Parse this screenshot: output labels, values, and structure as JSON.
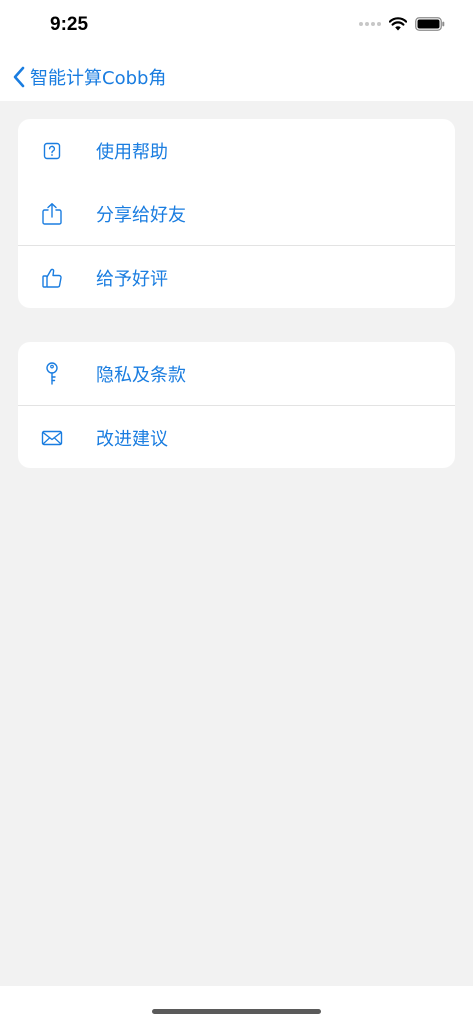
{
  "status_bar": {
    "time": "9:25"
  },
  "nav": {
    "title": "智能计算Cobb角",
    "back_icon": "chevron-left-icon"
  },
  "groups": [
    {
      "items": [
        {
          "label": "使用帮助",
          "icon": "question-mark-square-icon"
        },
        {
          "label": "分享给好友",
          "icon": "share-icon"
        },
        {
          "label": "给予好评",
          "icon": "thumbs-up-icon"
        }
      ]
    },
    {
      "items": [
        {
          "label": "隐私及条款",
          "icon": "key-icon"
        },
        {
          "label": "改进建议",
          "icon": "envelope-icon"
        }
      ]
    }
  ],
  "colors": {
    "accent": "#1a7de0",
    "background": "#f2f2f2",
    "card": "#ffffff"
  }
}
